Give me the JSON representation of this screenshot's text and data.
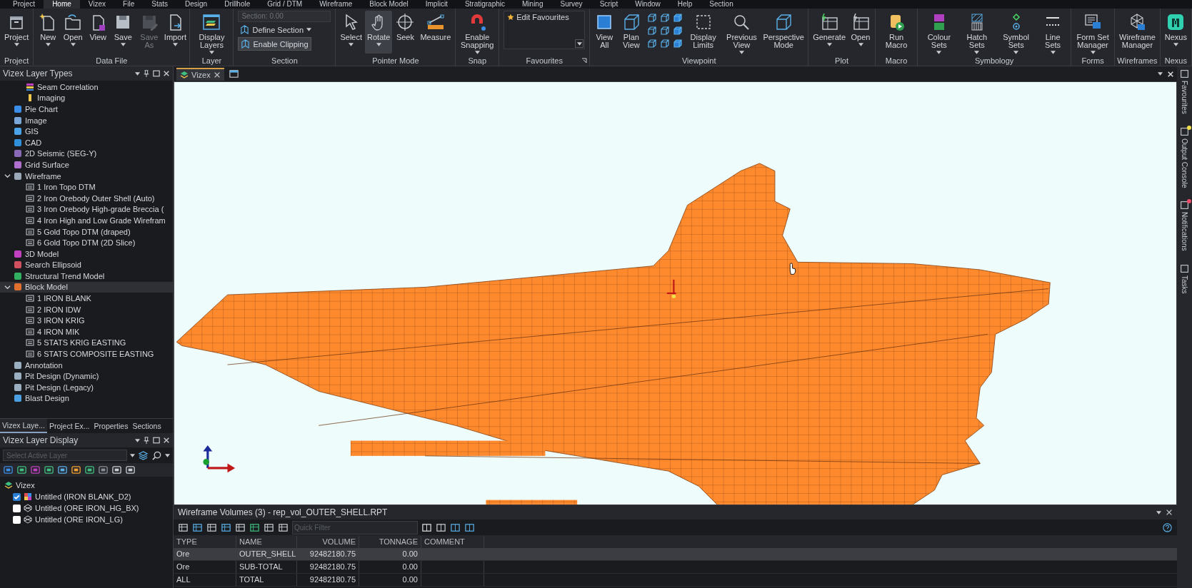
{
  "menu_bar": {
    "tabs": [
      {
        "label": "Project",
        "selected": false
      },
      {
        "label": "Home",
        "selected": true
      },
      {
        "label": "Vizex",
        "selected": false
      },
      {
        "label": "File",
        "selected": false
      },
      {
        "label": "Stats",
        "selected": false
      },
      {
        "label": "Design",
        "selected": false
      },
      {
        "label": "Drillhole",
        "selected": false
      },
      {
        "label": "Grid / DTM",
        "selected": false
      },
      {
        "label": "Wireframe",
        "selected": false
      },
      {
        "label": "Block Model",
        "selected": false
      },
      {
        "label": "Implicit",
        "selected": false
      },
      {
        "label": "Stratigraphic",
        "selected": false
      },
      {
        "label": "Mining",
        "selected": false
      },
      {
        "label": "Survey",
        "selected": false
      },
      {
        "label": "Script",
        "selected": false
      },
      {
        "label": "Window",
        "selected": false
      },
      {
        "label": "Help",
        "selected": false
      },
      {
        "label": "Section",
        "selected": false
      }
    ]
  },
  "ribbon": {
    "groups": [
      {
        "kind": "buttons",
        "label": "Project",
        "buttons": [
          {
            "kind": "button",
            "label": "Project",
            "menu": true,
            "disabled": false,
            "selected": false
          }
        ]
      },
      {
        "kind": "buttons",
        "label": "Data File",
        "buttons": [
          {
            "kind": "button",
            "label": "New",
            "menu": true,
            "disabled": false,
            "selected": false
          },
          {
            "kind": "button",
            "label": "Open",
            "menu": true,
            "disabled": false,
            "selected": false
          },
          {
            "kind": "button",
            "label": "View",
            "menu": false,
            "disabled": false,
            "selected": false
          },
          {
            "kind": "button",
            "label": "Save",
            "menu": true,
            "disabled": false,
            "selected": false
          },
          {
            "kind": "button",
            "label": "Save As",
            "menu": false,
            "disabled": true,
            "selected": false
          },
          {
            "kind": "button",
            "label": "Import",
            "menu": true,
            "disabled": false,
            "selected": false
          }
        ]
      },
      {
        "kind": "buttons",
        "label": "Layer",
        "buttons": [
          {
            "kind": "button",
            "label": "Display Layers",
            "menu": true,
            "disabled": false,
            "selected": false
          }
        ]
      },
      {
        "kind": "section",
        "label": "Section",
        "field": {
          "label": "Section:",
          "value": "0.00",
          "disabled": true
        },
        "define": {
          "label": "Define Section",
          "menu": true
        },
        "clipping": {
          "label": "Enable Clipping",
          "on": true
        }
      },
      {
        "kind": "buttons",
        "label": "Pointer Mode",
        "buttons": [
          {
            "kind": "button",
            "label": "Select",
            "menu": true,
            "disabled": false,
            "selected": false
          },
          {
            "kind": "button",
            "label": "Rotate",
            "menu": true,
            "disabled": false,
            "selected": true
          },
          {
            "kind": "button",
            "label": "Seek",
            "menu": false,
            "disabled": false,
            "selected": false
          },
          {
            "kind": "button",
            "label": "Measure",
            "menu": false,
            "disabled": false,
            "selected": false
          }
        ]
      },
      {
        "kind": "buttons",
        "label": "Snap",
        "buttons": [
          {
            "kind": "button",
            "label": "Enable Snapping",
            "menu": true,
            "disabled": false,
            "selected": false
          }
        ]
      },
      {
        "kind": "favourites",
        "label": "Favourites",
        "items": [
          "Edit Favourites"
        ]
      },
      {
        "kind": "buttons",
        "label": "Viewpoint",
        "buttons": [
          {
            "kind": "button",
            "label": "View All",
            "menu": false,
            "disabled": false,
            "selected": false
          },
          {
            "kind": "button",
            "label": "Plan View",
            "menu": false,
            "disabled": false,
            "selected": false
          },
          {
            "kind": "icon-grid"
          },
          {
            "kind": "button",
            "label": "Display Limits",
            "menu": false,
            "disabled": false,
            "selected": false
          },
          {
            "kind": "button",
            "label": "Previous View",
            "menu": true,
            "disabled": false,
            "selected": false
          },
          {
            "kind": "button",
            "label": "Perspective Mode",
            "menu": false,
            "disabled": false,
            "selected": false
          }
        ]
      },
      {
        "kind": "buttons",
        "label": "Plot",
        "buttons": [
          {
            "kind": "button",
            "label": "Generate",
            "menu": true,
            "disabled": false,
            "selected": false
          },
          {
            "kind": "button",
            "label": "Open",
            "menu": true,
            "disabled": false,
            "selected": false
          }
        ]
      },
      {
        "kind": "buttons",
        "label": "Macro",
        "buttons": [
          {
            "kind": "button",
            "label": "Run Macro",
            "menu": false,
            "disabled": false,
            "selected": false
          }
        ]
      },
      {
        "kind": "buttons",
        "label": "Symbology",
        "buttons": [
          {
            "kind": "button",
            "label": "Colour Sets",
            "menu": true,
            "disabled": false,
            "selected": false
          },
          {
            "kind": "button",
            "label": "Hatch Sets",
            "menu": true,
            "disabled": false,
            "selected": false
          },
          {
            "kind": "button",
            "label": "Symbol Sets",
            "menu": true,
            "disabled": false,
            "selected": false
          },
          {
            "kind": "button",
            "label": "Line Sets",
            "menu": true,
            "disabled": false,
            "selected": false
          }
        ]
      },
      {
        "kind": "buttons",
        "label": "Forms",
        "buttons": [
          {
            "kind": "button",
            "label": "Form Set Manager",
            "menu": true,
            "disabled": false,
            "selected": false
          }
        ]
      },
      {
        "kind": "buttons",
        "label": "Wireframes",
        "buttons": [
          {
            "kind": "button",
            "label": "Wireframe Manager",
            "menu": false,
            "disabled": false,
            "selected": false
          }
        ]
      },
      {
        "kind": "buttons",
        "label": "Nexus",
        "buttons": [
          {
            "kind": "button",
            "label": "Nexus",
            "menu": true,
            "disabled": false,
            "selected": false
          }
        ]
      }
    ]
  },
  "layer_types_panel": {
    "title": "Vizex Layer Types",
    "continued_children": [
      {
        "label": "Seam Correlation",
        "selected": false
      },
      {
        "label": "Imaging",
        "selected": false
      }
    ],
    "items": [
      {
        "label": "Pie Chart",
        "selected": false
      },
      {
        "label": "Image",
        "selected": false
      },
      {
        "label": "GIS",
        "selected": false
      },
      {
        "label": "CAD",
        "selected": false
      },
      {
        "label": "2D Seismic (SEG-Y)",
        "selected": false
      },
      {
        "label": "Grid Surface",
        "selected": false
      },
      {
        "label": "Wireframe",
        "selected": false,
        "expanded": true,
        "children": [
          {
            "label": "1 Iron Topo DTM",
            "selected": false
          },
          {
            "label": "2 Iron Orebody Outer Shell (Auto)",
            "selected": false
          },
          {
            "label": "3 Iron Orebody High-grade Breccia (",
            "selected": false
          },
          {
            "label": "4 Iron High and Low Grade Wirefram",
            "selected": false
          },
          {
            "label": "5 Gold Topo DTM (draped)",
            "selected": false
          },
          {
            "label": "6 Gold Topo DTM (2D Slice)",
            "selected": false
          }
        ]
      },
      {
        "label": "3D Model",
        "selected": false
      },
      {
        "label": "Search Ellipsoid",
        "selected": false
      },
      {
        "label": "Structural Trend Model",
        "selected": false
      },
      {
        "label": "Block Model",
        "selected": true,
        "expanded": true,
        "children": [
          {
            "label": "1 IRON BLANK",
            "selected": false
          },
          {
            "label": "2 IRON IDW",
            "selected": false
          },
          {
            "label": "3 IRON KRIG",
            "selected": false
          },
          {
            "label": "4 IRON MIK",
            "selected": false
          },
          {
            "label": "5 STATS KRIG EASTING",
            "selected": false
          },
          {
            "label": "6 STATS COMPOSITE EASTING",
            "selected": false
          }
        ]
      },
      {
        "label": "Annotation",
        "selected": false
      },
      {
        "label": "Pit Design (Dynamic)",
        "selected": false
      },
      {
        "label": "Pit Design (Legacy)",
        "selected": false
      },
      {
        "label": "Blast Design",
        "selected": false
      }
    ]
  },
  "panel_tabs": [
    {
      "label": "Vizex Laye...",
      "selected": true
    },
    {
      "label": "Project Ex...",
      "selected": false
    },
    {
      "label": "Properties",
      "selected": false
    },
    {
      "label": "Sections",
      "selected": false
    }
  ],
  "layer_display_panel": {
    "title": "Vizex Layer Display",
    "select": {
      "placeholder": "Select Active Layer"
    },
    "root": {
      "label": "Vizex",
      "children": [
        {
          "label": "Untitled (IRON BLANK_D2)",
          "checked": true
        },
        {
          "label": "Untitled (ORE IRON_HG_BX)",
          "checked": false
        },
        {
          "label": "Untitled (ORE IRON_LG)",
          "checked": false
        }
      ]
    }
  },
  "viewport": {
    "tabs": [
      {
        "label": "Vizex",
        "selected": true
      }
    ]
  },
  "report": {
    "title": "Wireframe Volumes (3) - rep_vol_OUTER_SHELL.RPT",
    "filter": {
      "placeholder": "Quick Filter"
    },
    "columns": [
      "TYPE",
      "NAME",
      "VOLUME",
      "TONNAGE",
      "COMMENT"
    ],
    "rows": [
      {
        "cells": [
          "Ore",
          "OUTER_SHELL",
          "92482180.75",
          "0.00",
          null
        ],
        "selected": true
      },
      {
        "cells": [
          "Ore",
          "SUB-TOTAL",
          "92482180.75",
          "0.00",
          null
        ],
        "selected": false
      },
      {
        "cells": [
          "ALL",
          "TOTAL",
          "92482180.75",
          "0.00",
          null
        ],
        "selected": false
      }
    ]
  },
  "side_tabs": [
    {
      "label": "Favourites"
    },
    {
      "label": "Output Console",
      "color": "#f2e04a"
    },
    {
      "label": "Notifications",
      "color": "#f04a6a"
    },
    {
      "label": "Tasks"
    }
  ]
}
